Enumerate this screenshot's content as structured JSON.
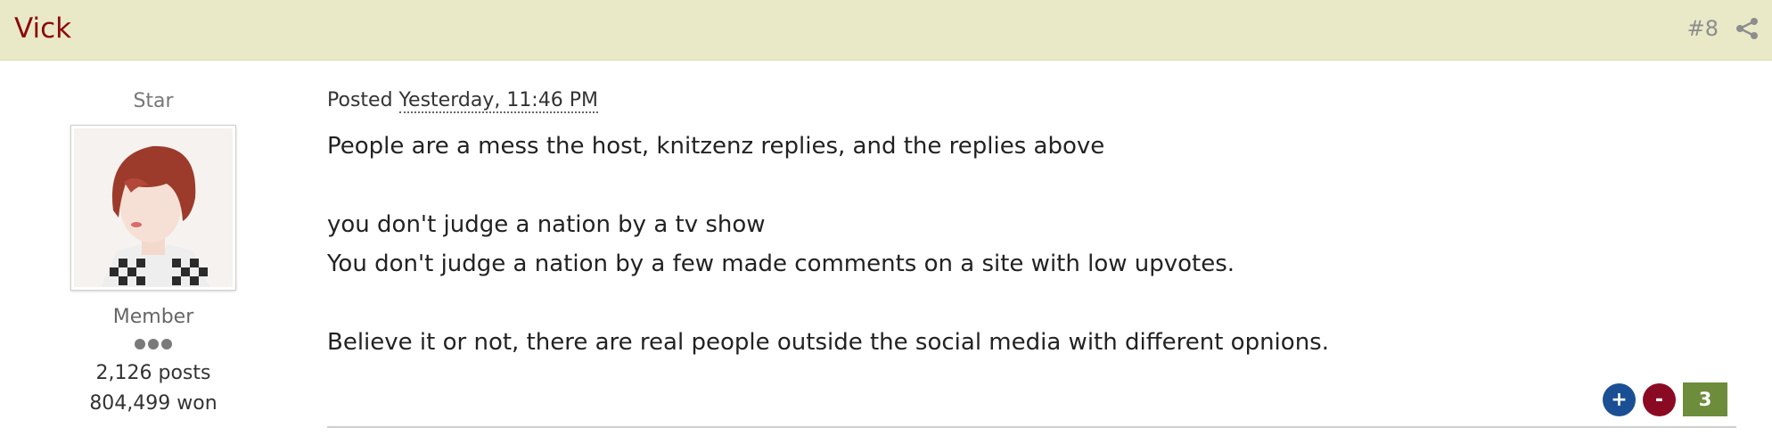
{
  "post": {
    "author": "Vick",
    "number": "#8",
    "share_icon": "share-icon"
  },
  "author_info": {
    "title": "Star",
    "avatar_alt": "avatar",
    "group": "Member",
    "posts": "2,126 posts",
    "won": "804,499 won"
  },
  "content": {
    "posted_prefix": "Posted",
    "posted_date": "Yesterday, 11:46 PM",
    "lines": [
      "People are a mess the host, knitzenz replies, and the replies above",
      "",
      "you don't judge a nation by a tv show",
      "You don't judge a nation by a few made comments on a site with low upvotes.",
      "",
      "Believe it or not, there are real people outside the social media with different opnions."
    ]
  },
  "reputation": {
    "plus_label": "+",
    "minus_label": "-",
    "count": "3",
    "colors": {
      "plus": "#1a4f94",
      "minus": "#8b0a23",
      "count": "#6d8c3c"
    }
  },
  "colors": {
    "header_bg": "#e9e9c8",
    "author_name": "#8b0a0a"
  }
}
